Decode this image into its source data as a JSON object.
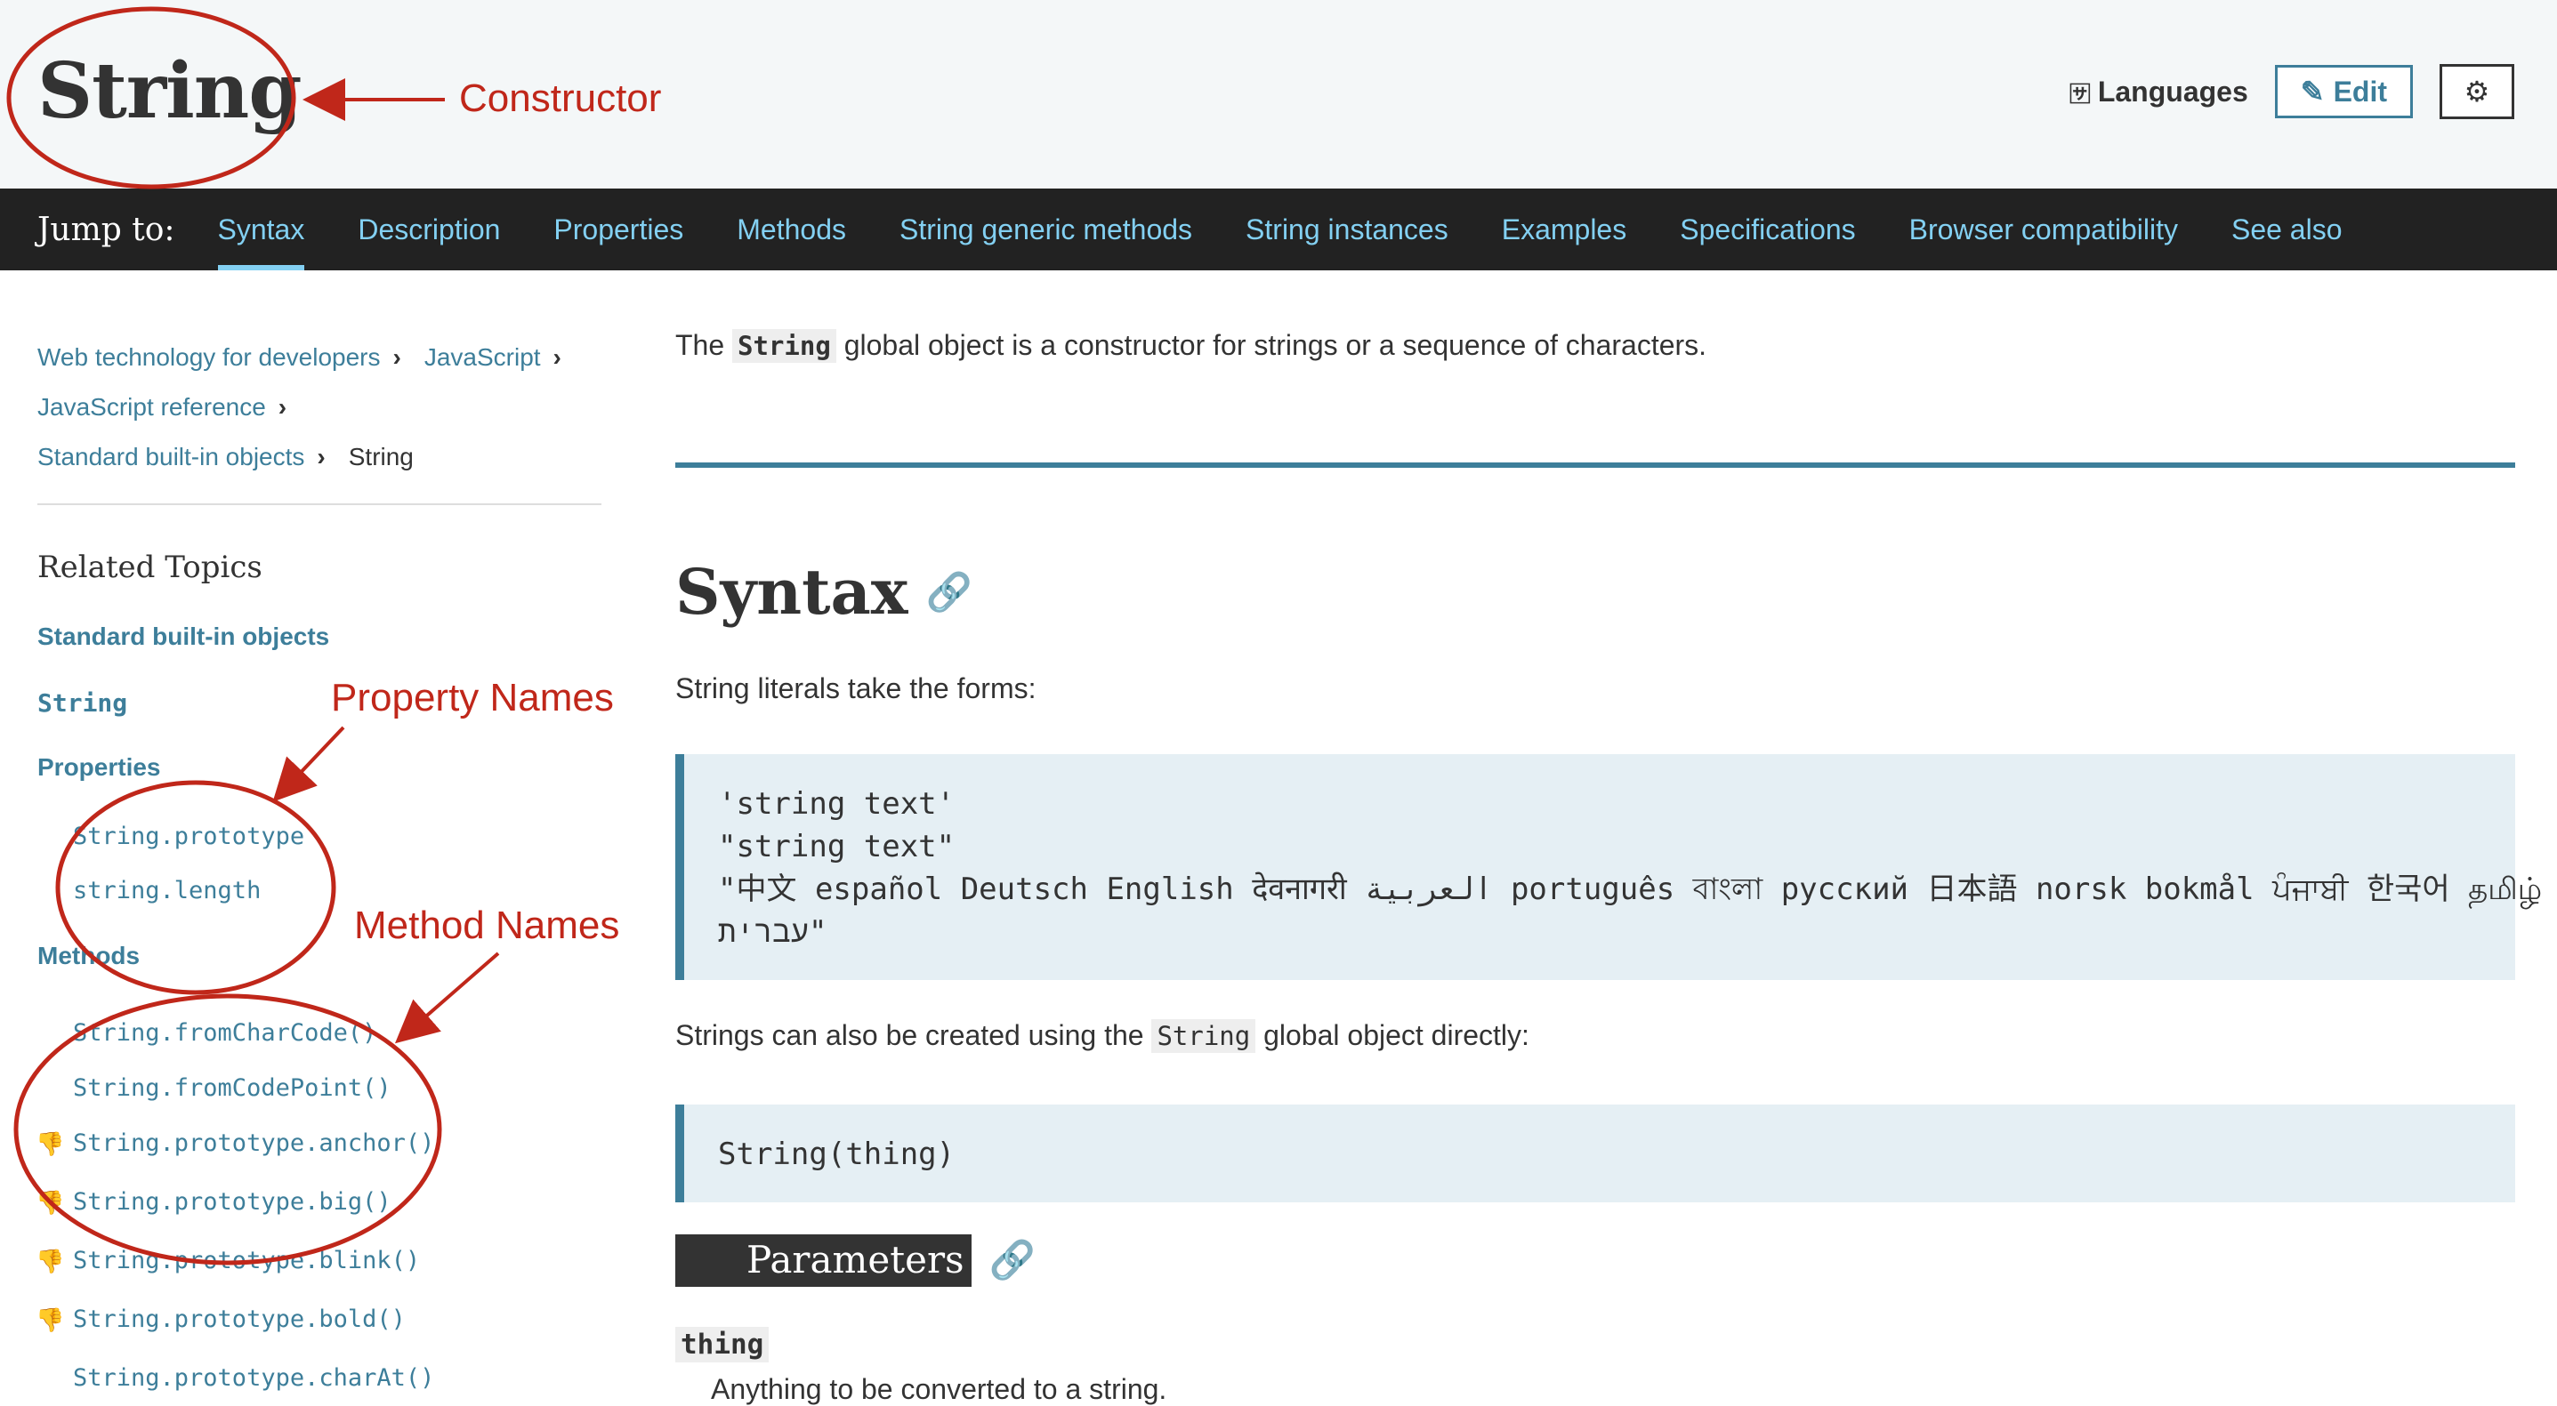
{
  "header": {
    "title": "String",
    "languages_label": "Languages",
    "edit_label": "Edit"
  },
  "jumpbar": {
    "label": "Jump to:",
    "links": [
      "Syntax",
      "Description",
      "Properties",
      "Methods",
      "String generic methods",
      "String instances",
      "Examples",
      "Specifications",
      "Browser compatibility",
      "See also"
    ],
    "active": "Syntax"
  },
  "breadcrumbs": {
    "items": [
      "Web technology for developers",
      "JavaScript",
      "JavaScript reference",
      "Standard built-in objects"
    ],
    "current": "String"
  },
  "sidebar": {
    "related_title": "Related Topics",
    "standard_objects": "Standard built-in objects",
    "string_link": "String",
    "properties_heading": "Properties",
    "properties": [
      "String.prototype",
      "string.length"
    ],
    "methods_heading": "Methods",
    "methods": [
      "String.fromCharCode()",
      "String.fromCodePoint()",
      "String.prototype.anchor()",
      "String.prototype.big()",
      "String.prototype.blink()",
      "String.prototype.bold()",
      "String.prototype.charAt()"
    ],
    "deprecated_methods": [
      false,
      false,
      true,
      true,
      true,
      true,
      false
    ]
  },
  "main": {
    "intro_before": "The ",
    "intro_code": "String",
    "intro_after": " global object is a constructor for strings or a sequence of characters.",
    "syntax_heading": "Syntax",
    "syntax_desc": "String literals take the forms:",
    "code1_line1": "'string text'",
    "code1_line2": "\"string text\"",
    "code1_line3": "\"中文 español Deutsch English देवनागरी العربية português বাংলা русский 日本語 norsk bokmål ਪੰਜਾਬੀ 한국어 தமிழ்",
    "code1_line4": "עברית\"",
    "direct_before": "Strings can also be created using the ",
    "direct_code": "String",
    "direct_after": " global object directly:",
    "code2": "String(thing)",
    "params_heading": "Parameters",
    "param_name": "thing",
    "param_desc": "Anything to be converted to a string."
  },
  "annotations": {
    "constructor": "Constructor",
    "property_names": "Property Names",
    "method_names": "Method Names",
    "color": "#c0271a"
  },
  "colors": {
    "link": "#3d7e9a",
    "jump_link": "#83d0f2",
    "jumpbar_bg": "#222222",
    "code_bg": "#e5eff4"
  }
}
